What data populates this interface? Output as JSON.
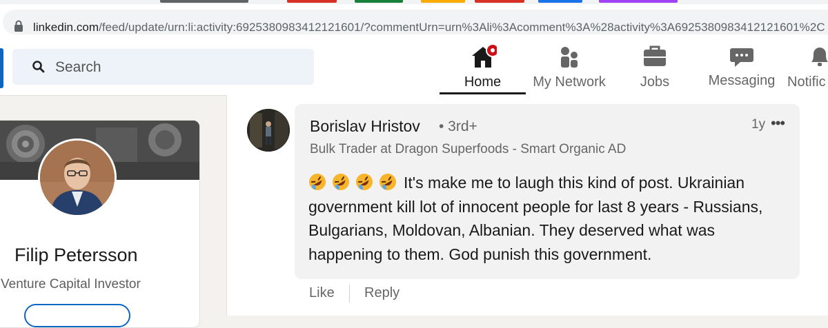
{
  "browser": {
    "url_host": "linkedin.com",
    "url_rest": "/feed/update/urn:li:activity:6925380983412121601/?commentUrn=urn%3Ali%3Acomment%3A%28activity%3A6925380983412121601%2C"
  },
  "nav": {
    "search_placeholder": "Search",
    "items": [
      {
        "label": "Home",
        "icon": "home-icon"
      },
      {
        "label": "My Network",
        "icon": "network-icon"
      },
      {
        "label": "Jobs",
        "icon": "briefcase-icon"
      },
      {
        "label": "Messaging",
        "icon": "messaging-icon"
      },
      {
        "label": "Notific",
        "icon": "bell-icon"
      }
    ]
  },
  "profile": {
    "name": "Filip Petersson",
    "title": "Venture Capital Investor"
  },
  "comment": {
    "author": "Borislav Hristov",
    "degree": "• 3rd+",
    "headline": "Bulk Trader at Dragon Superfoods - Smart Organic AD",
    "time": "1y",
    "more": "•••",
    "text": "It's make me to laugh this kind of post. Ukrainian government kill lot of innocent people for last 8 years - Russians, Bulgarians, Moldovan, Albanian. They deserved what was happening to them. God punish this government.",
    "emoji_icon": "rolling-on-floor-laughing-icon",
    "like_label": "Like",
    "reply_label": "Reply"
  },
  "colors": {
    "brand_blue": "#0a66c2",
    "notification_red": "#cc1016",
    "page_bg": "#f3f2ef"
  }
}
